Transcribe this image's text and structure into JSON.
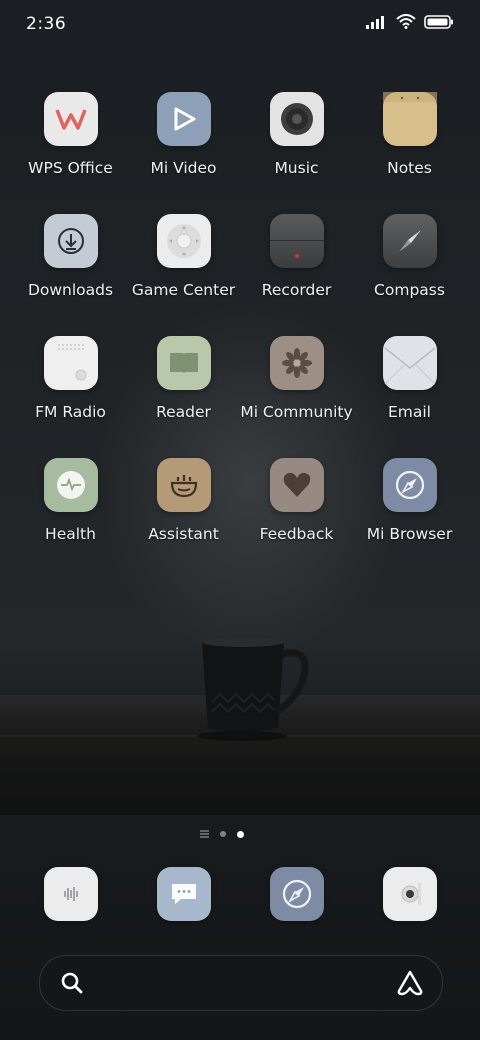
{
  "status_bar": {
    "time": "2:36",
    "icons": [
      "signal-icon",
      "wifi-icon",
      "battery-icon"
    ]
  },
  "apps": [
    {
      "label": "WPS Office",
      "icon": "wps-office-icon"
    },
    {
      "label": "Mi Video",
      "icon": "play-icon"
    },
    {
      "label": "Music",
      "icon": "speaker-icon"
    },
    {
      "label": "Notes",
      "icon": "notepad-icon"
    },
    {
      "label": "Downloads",
      "icon": "download-icon"
    },
    {
      "label": "Game Center",
      "icon": "gamepad-icon"
    },
    {
      "label": "Recorder",
      "icon": "recorder-icon"
    },
    {
      "label": "Compass",
      "icon": "compass-icon"
    },
    {
      "label": "FM Radio",
      "icon": "radio-icon"
    },
    {
      "label": "Reader",
      "icon": "book-icon"
    },
    {
      "label": "Mi Community",
      "icon": "flower-icon"
    },
    {
      "label": "Email",
      "icon": "envelope-icon"
    },
    {
      "label": "Health",
      "icon": "heartbeat-icon"
    },
    {
      "label": "Assistant",
      "icon": "assistant-icon"
    },
    {
      "label": "Feedback",
      "icon": "heart-icon"
    },
    {
      "label": "Mi Browser",
      "icon": "browser-compass-icon"
    }
  ],
  "page_indicator": {
    "pages": [
      "list",
      "page-1",
      "page-2"
    ],
    "current": 2
  },
  "dock": [
    {
      "icon": "phone-icon"
    },
    {
      "icon": "messages-icon"
    },
    {
      "icon": "browser-icon"
    },
    {
      "icon": "camera-icon"
    }
  ],
  "search_bar": {
    "left_icon": "search-icon",
    "right_icon": "assistant-a-icon"
  }
}
